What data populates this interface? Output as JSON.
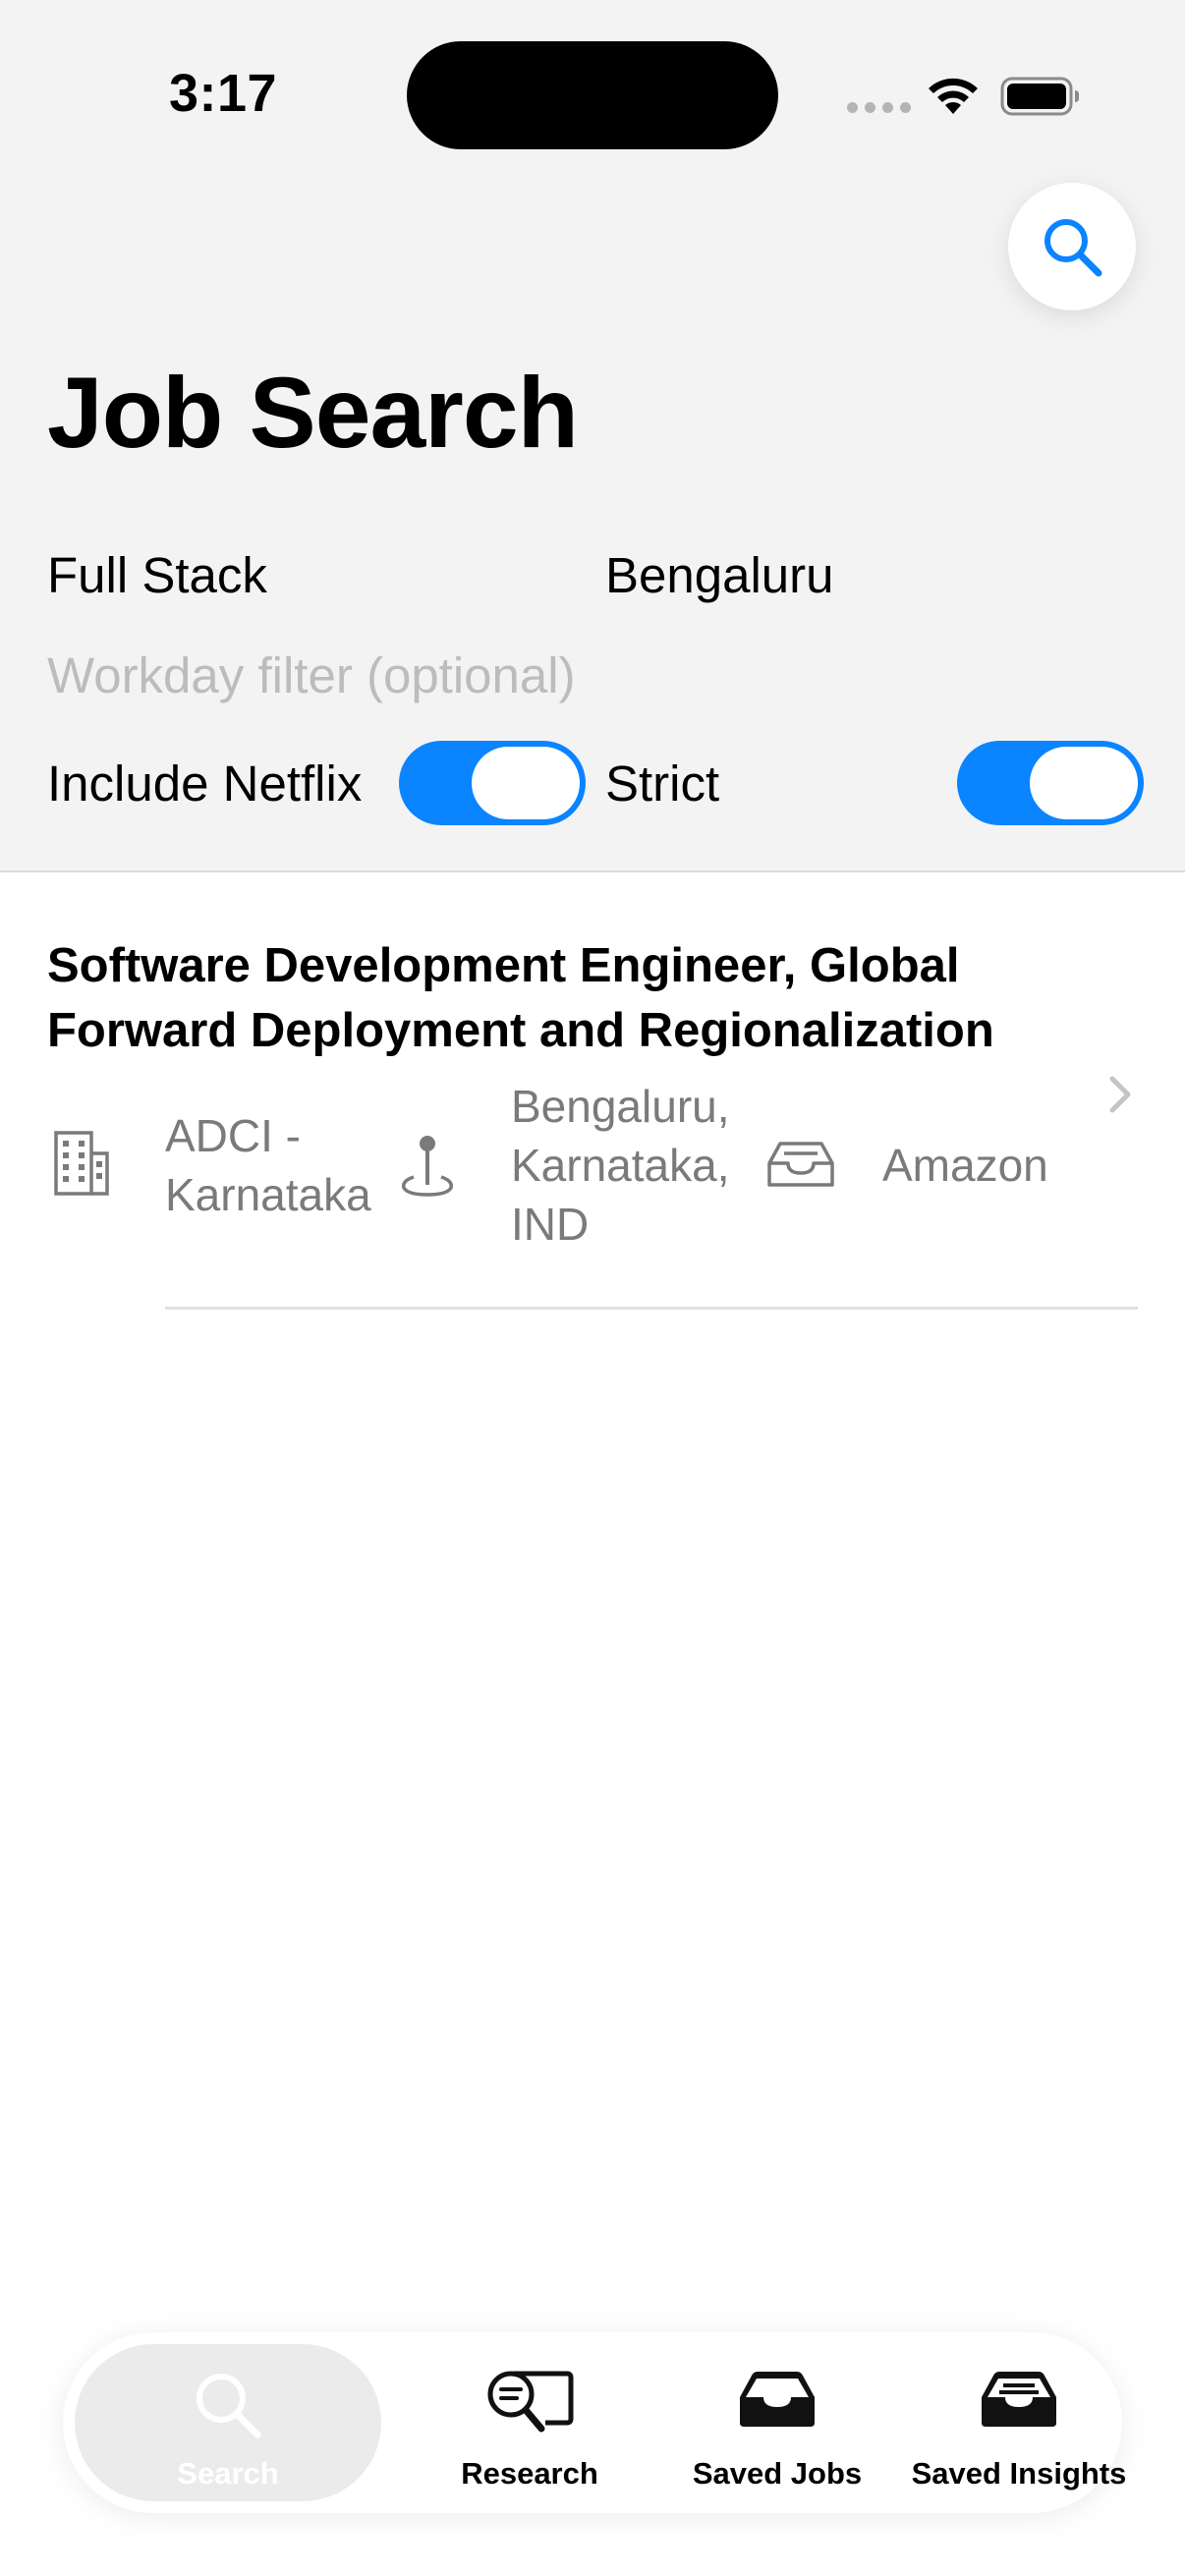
{
  "status_bar": {
    "time": "3:17"
  },
  "header": {
    "title": "Job Search"
  },
  "filters": {
    "role": "Full Stack",
    "city": "Bengaluru",
    "workday_placeholder": "Workday filter (optional)",
    "include_netflix_label": "Include Netflix",
    "include_netflix_on": true,
    "strict_label": "Strict",
    "strict_on": true
  },
  "jobs": [
    {
      "title": "Software Development Engineer, Global Forward Deployment and Regionalization",
      "org_line1": "ADCI -",
      "org_line2": "Karnataka",
      "loc_line1": "Bengaluru,",
      "loc_line2": "Karnataka,",
      "loc_line3": "IND",
      "company": "Amazon"
    }
  ],
  "tabs": [
    {
      "label": "Search",
      "icon": "search-icon",
      "active": true
    },
    {
      "label": "Research",
      "icon": "research-icon",
      "active": false
    },
    {
      "label": "Saved Jobs",
      "icon": "tray-icon",
      "active": false
    },
    {
      "label": "Saved Insights",
      "icon": "tray-full-icon",
      "active": false
    }
  ],
  "colors": {
    "accent": "#0a84ff",
    "background": "#f3f3f3",
    "secondary_text": "#7a7a7a",
    "placeholder": "#bcbcbc"
  }
}
